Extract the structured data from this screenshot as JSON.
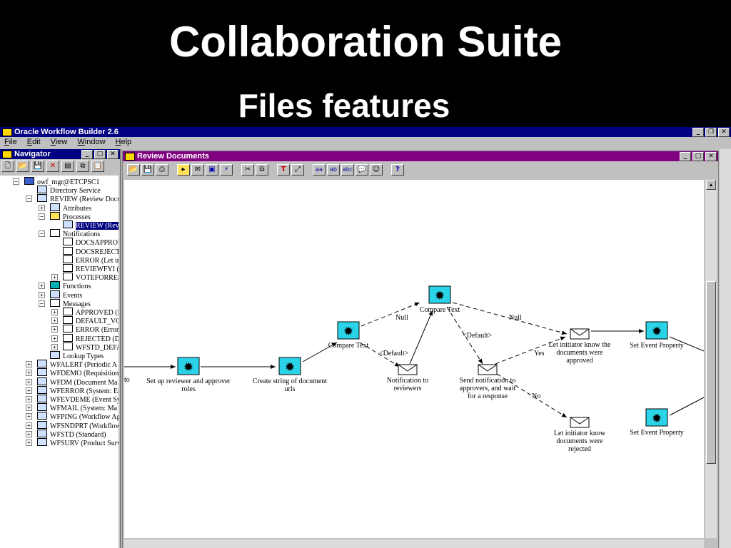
{
  "slide": {
    "title": "Collaboration Suite",
    "subtitle": "Files features"
  },
  "app": {
    "title": "Oracle Workflow Builder 2.6",
    "menu": [
      {
        "first": "F",
        "rest": "ile"
      },
      {
        "first": "E",
        "rest": "dit"
      },
      {
        "first": "V",
        "rest": "iew"
      },
      {
        "first": "W",
        "rest": "indow"
      },
      {
        "first": "H",
        "rest": "elp"
      }
    ]
  },
  "navigator": {
    "title": "Navigator",
    "tree": [
      {
        "label": "owf_mgr@ETCPSC1",
        "icon": "database-icon",
        "exp": "−"
      },
      {
        "label": "Directory Service",
        "icon": "directory-icon",
        "exp": ""
      },
      {
        "label": "REVIEW (Review Docu",
        "icon": "item-type-icon",
        "exp": "−"
      },
      {
        "label": "Attributes",
        "icon": "attributes-icon",
        "exp": "+"
      },
      {
        "label": "Processes",
        "icon": "folder-icon",
        "exp": "−"
      },
      {
        "label": "REVIEW (Revi",
        "icon": "process-icon",
        "exp": "",
        "selected": true
      },
      {
        "label": "Notifications",
        "icon": "notification-folder-icon",
        "exp": "−"
      },
      {
        "label": "DOCSAPPROV",
        "icon": "notification-icon",
        "exp": ""
      },
      {
        "label": "DOCSREJECTE",
        "icon": "notification-icon",
        "exp": ""
      },
      {
        "label": "ERROR (Let ini",
        "icon": "notification-icon",
        "exp": ""
      },
      {
        "label": "REVIEWFYI (N",
        "icon": "notification-icon",
        "exp": ""
      },
      {
        "label": "VOTEFORRESU",
        "icon": "notification-icon",
        "exp": "+"
      },
      {
        "label": "Functions",
        "icon": "function-icon",
        "exp": "+"
      },
      {
        "label": "Events",
        "icon": "event-icon",
        "exp": "+"
      },
      {
        "label": "Messages",
        "icon": "message-folder-icon",
        "exp": "−"
      },
      {
        "label": "APPROVED (D",
        "icon": "message-icon",
        "exp": "+"
      },
      {
        "label": "DEFAULT_VO",
        "icon": "message-icon",
        "exp": "+"
      },
      {
        "label": "ERROR (Error i",
        "icon": "message-icon",
        "exp": "+"
      },
      {
        "label": "REJECTED (Do",
        "icon": "message-icon",
        "exp": "+"
      },
      {
        "label": "WFSTD_DEFA",
        "icon": "message-icon",
        "exp": "+"
      },
      {
        "label": "Lookup Types",
        "icon": "lookup-icon",
        "exp": ""
      },
      {
        "label": "WFALERT (Periodic A",
        "icon": "item-type-icon",
        "exp": "+"
      },
      {
        "label": "WFDEMO (Requisition)",
        "icon": "item-type-icon",
        "exp": "+"
      },
      {
        "label": "WFDM (Document Ma",
        "icon": "item-type-icon",
        "exp": "+"
      },
      {
        "label": "WFERROR (System: Er",
        "icon": "item-type-icon",
        "exp": "+"
      },
      {
        "label": "WFEVDEME (Event Sy",
        "icon": "item-type-icon",
        "exp": "+"
      },
      {
        "label": "WFMAIL (System: Ma",
        "icon": "item-type-icon",
        "exp": "+"
      },
      {
        "label": "WFPING (Workflow Ag",
        "icon": "item-type-icon",
        "exp": "+"
      },
      {
        "label": "WFSNDPRT (Workflow",
        "icon": "item-type-icon",
        "exp": "+"
      },
      {
        "label": "WFSTD (Standard)",
        "icon": "item-type-icon",
        "exp": "+"
      },
      {
        "label": "WFSURV (Product Surv",
        "icon": "item-type-icon",
        "exp": "+"
      }
    ]
  },
  "process": {
    "title": "Review Documents",
    "nodes": [
      {
        "id": "start",
        "type": "function",
        "label": "Set up reviewer and approver roles"
      },
      {
        "id": "create",
        "type": "function",
        "label": "Create string of document urls"
      },
      {
        "id": "cmp1",
        "type": "function",
        "label": "Compare Text"
      },
      {
        "id": "cmp2",
        "type": "function",
        "label": "Compare Text"
      },
      {
        "id": "notif",
        "type": "notification",
        "label": "Notification to reviewers"
      },
      {
        "id": "send",
        "type": "notification",
        "label": "Send notification to approvers, and wait for a response"
      },
      {
        "id": "letyes",
        "type": "notification",
        "label": "Let initiator know the documents were approved"
      },
      {
        "id": "letno",
        "type": "notification",
        "label": "Let initiator know documents were rejected"
      },
      {
        "id": "setev1",
        "type": "function",
        "label": "Set Event Property"
      },
      {
        "id": "setev2",
        "type": "function",
        "label": "Set Event Property"
      }
    ],
    "edge_labels": {
      "null1": "Null",
      "null2": "Null",
      "default1": "<Default>",
      "default2": "<Default>",
      "yes": "Yes",
      "no": "No"
    },
    "partial_label": "to"
  },
  "colors": {
    "desktop": "#000000",
    "app_title_bar": "#000080",
    "process_title_bar": "#800080",
    "function_node": "#2ad3e8"
  }
}
